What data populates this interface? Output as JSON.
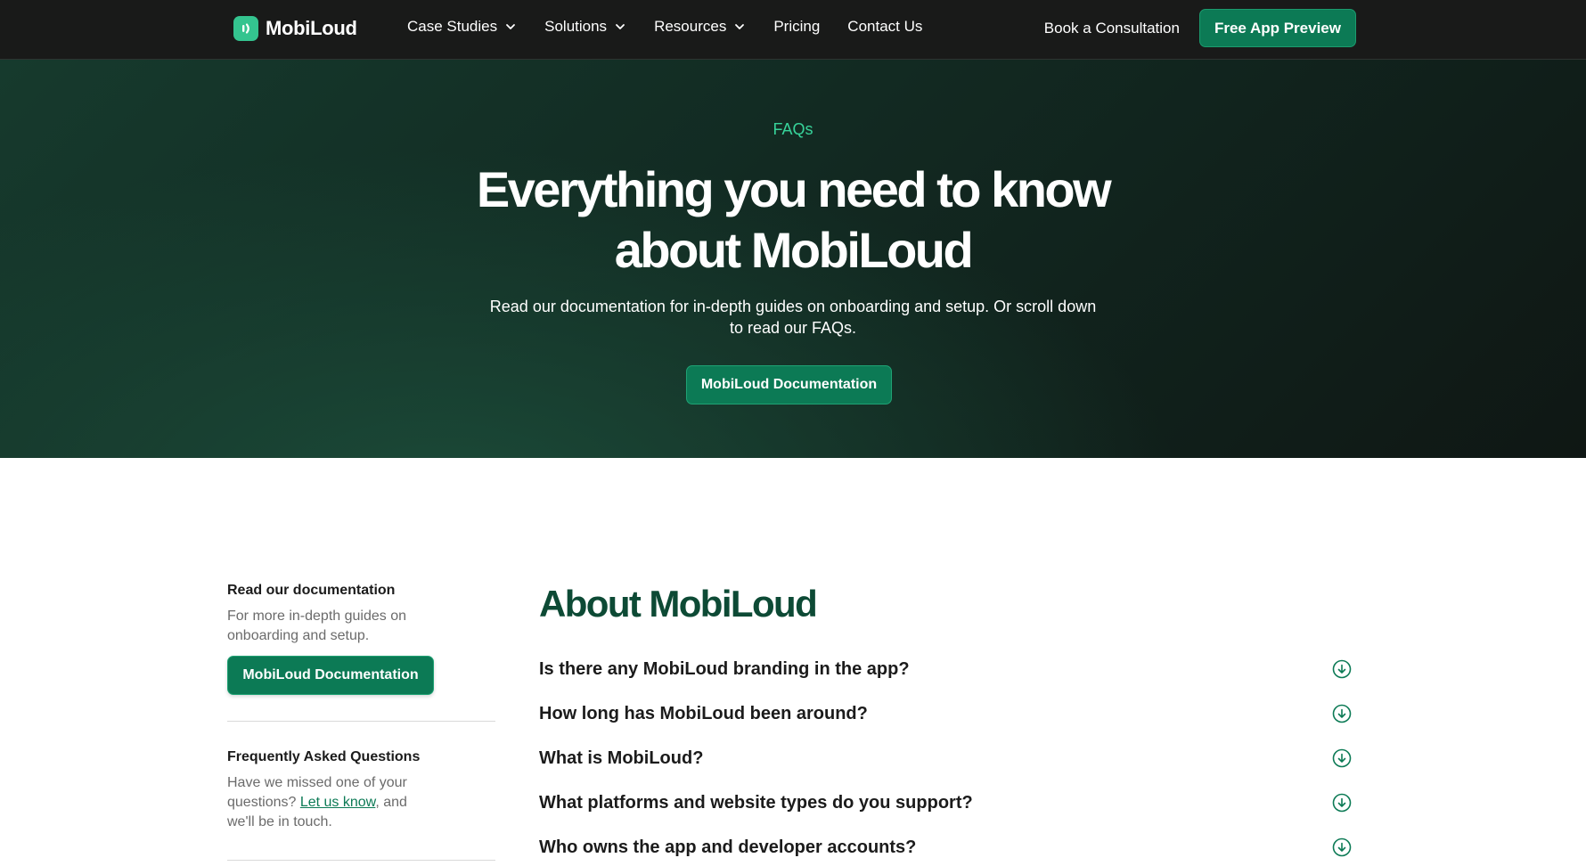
{
  "nav": {
    "logo_text": "MobiLoud",
    "items": [
      {
        "label": "Case Studies",
        "dropdown": true
      },
      {
        "label": "Solutions",
        "dropdown": true
      },
      {
        "label": "Resources",
        "dropdown": true
      },
      {
        "label": "Pricing",
        "dropdown": false
      },
      {
        "label": "Contact Us",
        "dropdown": false
      }
    ],
    "consult_label": "Book a Consultation",
    "preview_label": "Free App Preview"
  },
  "hero": {
    "eyebrow": "FAQs",
    "title_line1": "Everything you need to know",
    "title_line2": "about MobiLoud",
    "subtitle": "Read our documentation for in-depth guides on onboarding and setup. Or scroll down to read our FAQs.",
    "button_label": "MobiLoud Documentation"
  },
  "sidebar": {
    "docs_heading": "Read our documentation",
    "docs_text": "For more in-depth guides on onboarding and setup.",
    "docs_button": "MobiLoud Documentation",
    "faq_heading": "Frequently Asked Questions",
    "faq_text_before": "Have we missed one of your questions? ",
    "faq_link": "Let us know",
    "faq_text_after": ", and we'll be in touch."
  },
  "main": {
    "section_title": "About MobiLoud",
    "questions": [
      "Is there any MobiLoud branding in the app?",
      "How long has MobiLoud been around?",
      "What is MobiLoud?",
      "What platforms and website types do you support?",
      "Who owns the app and developer accounts?"
    ]
  },
  "colors": {
    "brand_green": "#0c7a55",
    "accent_green": "#37d39a",
    "heading_green": "#0d4a35",
    "nav_bg": "#191a19"
  },
  "icons": {
    "logo": "logo-mark-icon",
    "dropdown": "chevron-down-icon",
    "faq_toggle": "circle-arrow-down-icon"
  }
}
